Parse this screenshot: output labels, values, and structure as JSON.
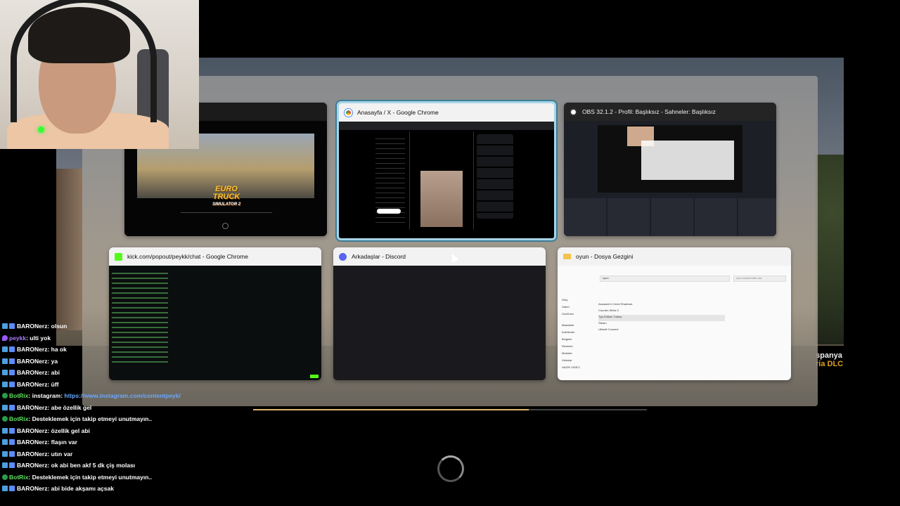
{
  "game_overlay": {
    "right_text_line1": "spanya",
    "right_text_line2": "ria DLC"
  },
  "window_switcher": {
    "tiles": [
      {
        "title": "",
        "icon": "euro-truck-icon"
      },
      {
        "title": "Anasayfa / X - Google Chrome",
        "icon": "chrome-icon",
        "selected": true
      },
      {
        "title": "OBS 32.1.2 - Profil: Başlıksız - Sahneler: Başlıksız",
        "icon": "obs-icon"
      },
      {
        "title": "kick.com/popout/peykk/chat - Google Chrome",
        "icon": "kick-icon"
      },
      {
        "title": "Arkadaşlar - Discord",
        "icon": "discord-icon"
      },
      {
        "title": "oyun - Dosya Gezgini",
        "icon": "folder-icon"
      }
    ],
    "game_tile": {
      "logo_line1": "EURO TRUCK",
      "logo_line2": "SIMULATOR 2"
    },
    "explorer": {
      "path": "oyun",
      "search_placeholder": "oyun klasöründe ara",
      "sidebar": [
        "Giriş",
        "Galeri",
        "OneDrive",
        "Masaüstü",
        "İndirilenler",
        "Belgeler",
        "Resimler",
        "Müzikler",
        "Videolar",
        "HAZIR VIDEO"
      ],
      "files": [
        "Assassin's Creed Shadows",
        "Counter-Strike 2",
        "Tgx-Edition Turkey",
        "Steam",
        "Ubisoft Connect"
      ]
    }
  },
  "chat": {
    "messages": [
      {
        "badge": "mod",
        "user": "BARONerz",
        "color": "#ffffff",
        "text": ": olsun"
      },
      {
        "badge": "own",
        "user": "peykk",
        "color": "#a77dff",
        "text": ": ulti yok"
      },
      {
        "badge": "mod",
        "user": "BARONerz",
        "color": "#ffffff",
        "text": ": ha ok"
      },
      {
        "badge": "mod",
        "user": "BARONerz",
        "color": "#ffffff",
        "text": ": ya"
      },
      {
        "badge": "mod",
        "user": "BARONerz",
        "color": "#ffffff",
        "text": ": abi"
      },
      {
        "badge": "mod",
        "user": "BARONerz",
        "color": "#ffffff",
        "text": ": üff"
      },
      {
        "badge": "bot",
        "user": "BotRix",
        "color": "#5fe05f",
        "text": ": instagram: ",
        "link": "https://www.instagram.com/contentpeyk/"
      },
      {
        "badge": "mod",
        "user": "BARONerz",
        "color": "#ffffff",
        "text": ": abe özellik gel"
      },
      {
        "badge": "bot",
        "user": "BotRix",
        "color": "#5fe05f",
        "text": ": Desteklemek için takip etmeyi unutmayın.."
      },
      {
        "badge": "mod",
        "user": "BARONerz",
        "color": "#ffffff",
        "text": ": özellik gel abi"
      },
      {
        "badge": "mod",
        "user": "BARONerz",
        "color": "#ffffff",
        "text": ": flaşın var"
      },
      {
        "badge": "mod",
        "user": "BARONerz",
        "color": "#ffffff",
        "text": ": utın var"
      },
      {
        "badge": "mod",
        "user": "BARONerz",
        "color": "#ffffff",
        "text": ": ok abi ben akf 5 dk çiş molası"
      },
      {
        "badge": "bot",
        "user": "BotRix",
        "color": "#5fe05f",
        "text": ": Desteklemek için takip etmeyi unutmayın.."
      },
      {
        "badge": "mod",
        "user": "BARONerz",
        "color": "#ffffff",
        "text": ": abi bide akşamı açsak"
      }
    ]
  },
  "progress": {
    "fraction": 0.7
  },
  "colors": {
    "selection_border": "#a6d5e8",
    "mod_badge": "#4aa0e0",
    "bot_name": "#5fe05f",
    "owner_name": "#a77dff",
    "progress": "#d8b56a"
  }
}
